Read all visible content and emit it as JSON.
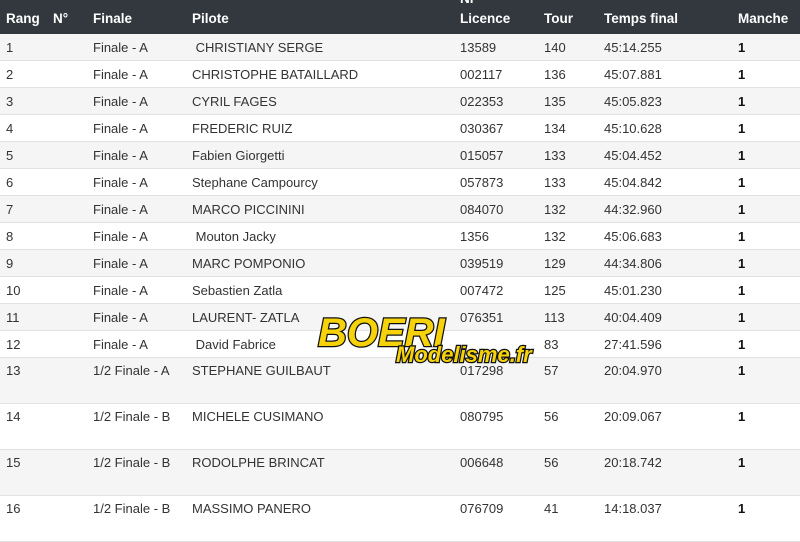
{
  "table": {
    "headers": {
      "rang": "Rang",
      "no": "N°",
      "finale": "Finale",
      "pilote": "Pilote",
      "licence_top": "Nr",
      "licence_bottom": "Licence",
      "tour": "Tour",
      "temps": "Temps final",
      "manche": "Manche"
    },
    "rows": [
      {
        "rang": "1",
        "finale": "Finale - A",
        "pilote": " CHRISTIANY SERGE",
        "licence": "13589",
        "tour": "140",
        "temps": "45:14.255",
        "manche": "1"
      },
      {
        "rang": "2",
        "finale": "Finale - A",
        "pilote": "CHRISTOPHE BATAILLARD",
        "licence": "002117",
        "tour": "136",
        "temps": "45:07.881",
        "manche": "1"
      },
      {
        "rang": "3",
        "finale": "Finale - A",
        "pilote": "CYRIL FAGES",
        "licence": "022353",
        "tour": "135",
        "temps": "45:05.823",
        "manche": "1"
      },
      {
        "rang": "4",
        "finale": "Finale - A",
        "pilote": "FREDERIC RUIZ",
        "licence": "030367",
        "tour": "134",
        "temps": "45:10.628",
        "manche": "1"
      },
      {
        "rang": "5",
        "finale": "Finale - A",
        "pilote": "Fabien Giorgetti",
        "licence": "015057",
        "tour": "133",
        "temps": "45:04.452",
        "manche": "1"
      },
      {
        "rang": "6",
        "finale": "Finale - A",
        "pilote": "Stephane Campourcy",
        "licence": "057873",
        "tour": "133",
        "temps": "45:04.842",
        "manche": "1"
      },
      {
        "rang": "7",
        "finale": "Finale - A",
        "pilote": "MARCO PICCININI",
        "licence": "084070",
        "tour": "132",
        "temps": "44:32.960",
        "manche": "1"
      },
      {
        "rang": "8",
        "finale": "Finale - A",
        "pilote": " Mouton Jacky",
        "licence": "1356",
        "tour": "132",
        "temps": "45:06.683",
        "manche": "1"
      },
      {
        "rang": "9",
        "finale": "Finale - A",
        "pilote": "MARC POMPONIO",
        "licence": "039519",
        "tour": "129",
        "temps": "44:34.806",
        "manche": "1"
      },
      {
        "rang": "10",
        "finale": "Finale - A",
        "pilote": "Sebastien Zatla",
        "licence": "007472",
        "tour": "125",
        "temps": "45:01.230",
        "manche": "1"
      },
      {
        "rang": "11",
        "finale": "Finale - A",
        "pilote": "LAURENT- ZATLA",
        "licence": "076351",
        "tour": "113",
        "temps": "40:04.409",
        "manche": "1"
      },
      {
        "rang": "12",
        "finale": "Finale - A",
        "pilote": " David Fabrice",
        "licence": "",
        "tour": "83",
        "temps": "27:41.596",
        "manche": "1"
      },
      {
        "rang": "13",
        "finale": "1/2 Finale - A",
        "pilote": "STEPHANE GUILBAUT",
        "licence": "017298",
        "tour": "57",
        "temps": "20:04.970",
        "manche": "1"
      },
      {
        "rang": "14",
        "finale": "1/2 Finale - B",
        "pilote": "MICHELE CUSIMANO",
        "licence": "080795",
        "tour": "56",
        "temps": "20:09.067",
        "manche": "1"
      },
      {
        "rang": "15",
        "finale": "1/2 Finale - B",
        "pilote": "RODOLPHE BRINCAT",
        "licence": "006648",
        "tour": "56",
        "temps": "20:18.742",
        "manche": "1"
      },
      {
        "rang": "16",
        "finale": "1/2 Finale - B",
        "pilote": "MASSIMO PANERO",
        "licence": "076709",
        "tour": "41",
        "temps": "14:18.037",
        "manche": "1"
      }
    ]
  },
  "logo": {
    "text_main": "BOERI",
    "text_sub": "Modelisme.fr",
    "colors": {
      "yellow": "#f5d20a",
      "black": "#111111"
    }
  }
}
